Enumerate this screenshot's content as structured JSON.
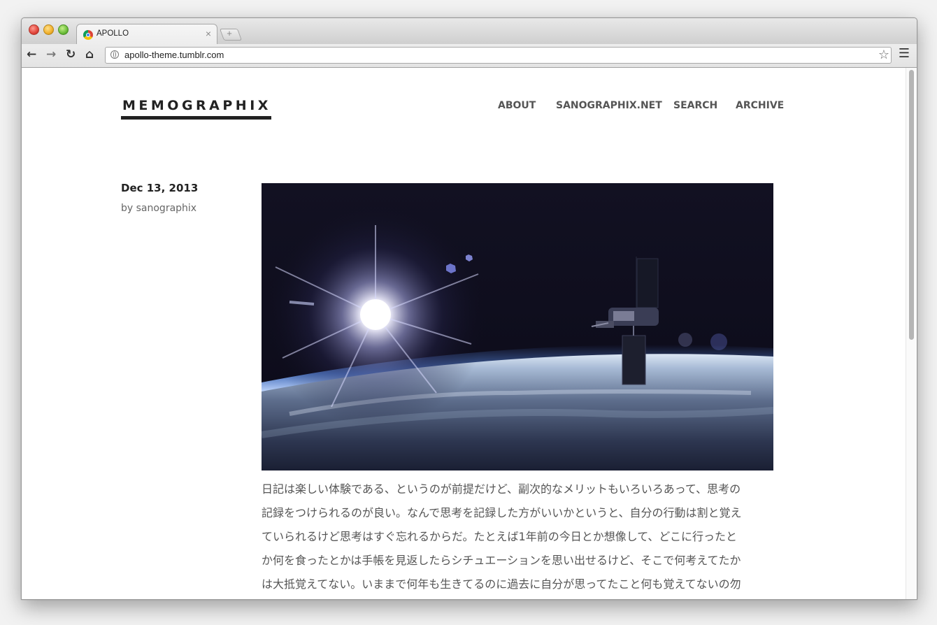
{
  "browser": {
    "tab_title": "APOLLO",
    "tab_close": "×",
    "new_tab": "+",
    "url": "apollo-theme.tumblr.com",
    "icons": {
      "back": "arrow-left",
      "forward": "arrow-right",
      "reload": "reload",
      "home": "home",
      "bookmark": "star",
      "menu": "hamburger"
    }
  },
  "site": {
    "title": "MEMOGRAPHIX",
    "nav": [
      "ABOUT",
      "SANOGRAPHIX.NET",
      "SEARCH",
      "ARCHIVE"
    ]
  },
  "post": {
    "date": "Dec 13, 2013",
    "author": "by sanographix",
    "image_alt": "satellite in orbit over Earth with sunburst",
    "body_lines": [
      "日記は楽しい体験である、というのが前提だけど、副次的なメリットもいろいろあって、思考の",
      "記録をつけられるのが良い。なんで思考を記録した方がいいかというと、自分の行動は割と覚え",
      "ていられるけど思考はすぐ忘れるからだ。たとえば1年前の今日とか想像して、どこに行ったと",
      "か何を食ったとかは手帳を見返したらシチュエーションを思い出せるけど、そこで何考えてたか",
      "は大抵覚えてない。いままで何年も生きてるのに過去に自分が思ってたこと何も覚えてないの勿"
    ]
  },
  "colors": {
    "title_text": "#222222",
    "nav_text": "#555555",
    "body_text": "#555555",
    "page_bg": "#ffffff"
  }
}
